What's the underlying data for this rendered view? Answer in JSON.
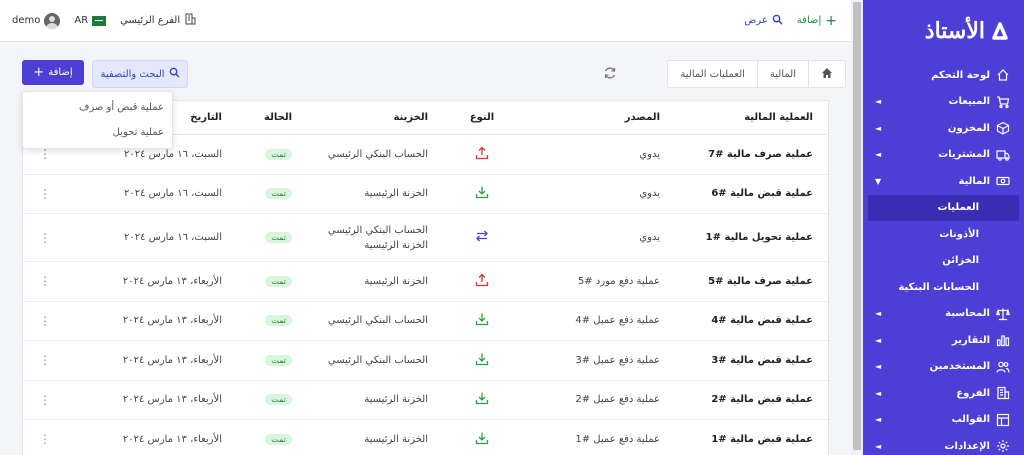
{
  "topbar": {
    "user_name": "demo",
    "language": "AR",
    "branch": "الفرع الرئيسي",
    "view_label": "عرض",
    "add_label": "إضافة"
  },
  "sidebar": {
    "logo": "الأستاذ",
    "items": [
      {
        "label": "لوحة التحكم",
        "icon": "home-icon",
        "caret": ""
      },
      {
        "label": "المبيعات",
        "icon": "cart-icon",
        "caret": "◄"
      },
      {
        "label": "المخزون",
        "icon": "box-icon",
        "caret": "◄"
      },
      {
        "label": "المشتريات",
        "icon": "truck-icon",
        "caret": "◄"
      },
      {
        "label": "المالية",
        "icon": "money-icon",
        "caret": "▼"
      }
    ],
    "sub_items": [
      "العمليات",
      "الأذونات",
      "الخزائن",
      "الحسابات البنكية"
    ],
    "items_after": [
      {
        "label": "المحاسبة",
        "icon": "scale-icon",
        "caret": "◄"
      },
      {
        "label": "التقارير",
        "icon": "chart-icon",
        "caret": "◄"
      },
      {
        "label": "المستخدمين",
        "icon": "users-icon",
        "caret": "◄"
      },
      {
        "label": "الفروع",
        "icon": "building-icon",
        "caret": "◄"
      },
      {
        "label": "القوالب",
        "icon": "template-icon",
        "caret": "◄"
      },
      {
        "label": "الإعدادات",
        "icon": "gear-icon",
        "caret": "◄"
      }
    ]
  },
  "breadcrumb": [
    "المالية",
    "العمليات المالية"
  ],
  "actions": {
    "add_label": "إضافة",
    "search_label": "البحث والتصفية"
  },
  "dropdown": [
    "عملية قبض أو صرف",
    "عملية تحويل"
  ],
  "table": {
    "headers": [
      "العملية المالية",
      "المصدر",
      "النوع",
      "الخزينة",
      "الحالة",
      "التاريخ"
    ],
    "rows": [
      {
        "op": "عملية صرف مالية #7",
        "src": "يدوي",
        "type": "out",
        "box": [
          "الحساب البنكي الرئيسي"
        ],
        "state": "تمت",
        "date": "السبت، ١٦ مارس ٢٠٢٤"
      },
      {
        "op": "عملية قبض مالية #6",
        "src": "يدوي",
        "type": "in",
        "box": [
          "الخزنة الرئيسية"
        ],
        "state": "تمت",
        "date": "السبت، ١٦ مارس ٢٠٢٤"
      },
      {
        "op": "عملية تحويل مالية #1",
        "src": "يدوي",
        "type": "transfer",
        "box": [
          "الحساب البنكي الرئيسي",
          "الخزنة الرئيسية"
        ],
        "state": "تمت",
        "date": "السبت، ١٦ مارس ٢٠٢٤"
      },
      {
        "op": "عملية صرف مالية #5",
        "src": "عملية دفع مورد #5",
        "type": "out",
        "box": [
          "الخزنة الرئيسية"
        ],
        "state": "تمت",
        "date": "الأربعاء، ١٣ مارس ٢٠٢٤"
      },
      {
        "op": "عملية قبض مالية #4",
        "src": "عملية دفع عميل #4",
        "type": "in",
        "box": [
          "الحساب البنكي الرئيسي"
        ],
        "state": "تمت",
        "date": "الأربعاء، ١٣ مارس ٢٠٢٤"
      },
      {
        "op": "عملية قبض مالية #3",
        "src": "عملية دفع عميل #3",
        "type": "in",
        "box": [
          "الحساب البنكي الرئيسي"
        ],
        "state": "تمت",
        "date": "الأربعاء، ١٣ مارس ٢٠٢٤"
      },
      {
        "op": "عملية قبض مالية #2",
        "src": "عملية دفع عميل #2",
        "type": "in",
        "box": [
          "الخزنة الرئيسية"
        ],
        "state": "تمت",
        "date": "الأربعاء، ١٣ مارس ٢٠٢٤"
      },
      {
        "op": "عملية قبض مالية #1",
        "src": "عملية دفع عميل #1",
        "type": "in",
        "box": [
          "الخزنة الرئيسية"
        ],
        "state": "تمت",
        "date": "الأربعاء، ١٣ مارس ٢٠٢٤"
      }
    ]
  },
  "colors": {
    "primary": "#4d3ed6",
    "out_arrow": "#e03131",
    "in_arrow": "#2f9e44",
    "transfer_arrow": "#4d3ed6"
  }
}
